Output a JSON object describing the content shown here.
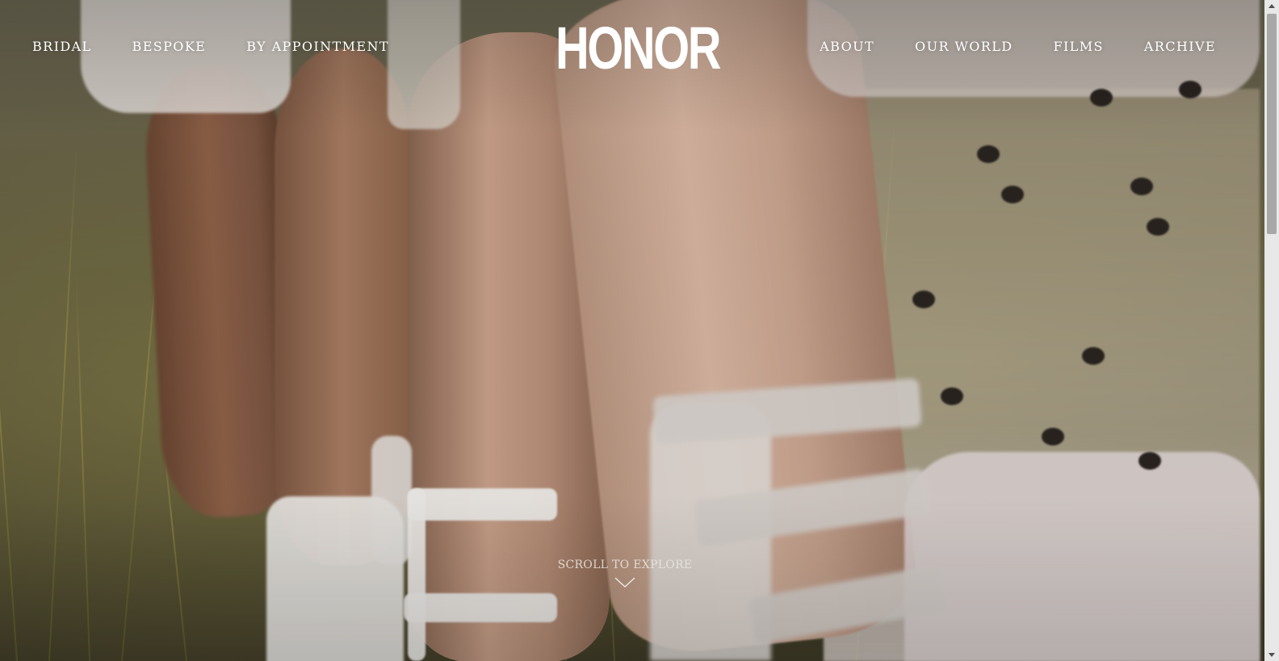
{
  "brand": {
    "logo_text": "HONOR"
  },
  "nav": {
    "left": [
      {
        "label": "BRIDAL"
      },
      {
        "label": "BESPOKE"
      },
      {
        "label": "BY APPOINTMENT"
      }
    ],
    "right": [
      {
        "label": "ABOUT"
      },
      {
        "label": "OUR WORLD"
      },
      {
        "label": "FILMS"
      },
      {
        "label": "ARCHIVE"
      }
    ]
  },
  "hero": {
    "scroll_label": "SCROLL TO EXPLORE",
    "icon": "chevron-down-icon"
  },
  "scrollbar": {
    "up_icon": "triangle-up-icon",
    "down_icon": "triangle-down-icon"
  },
  "colors": {
    "nav_text": "#ffffff",
    "scroll_label": "#ebe8e1",
    "scrollbar_track": "#e8e8e8",
    "scrollbar_thumb": "#a8a8a8"
  }
}
